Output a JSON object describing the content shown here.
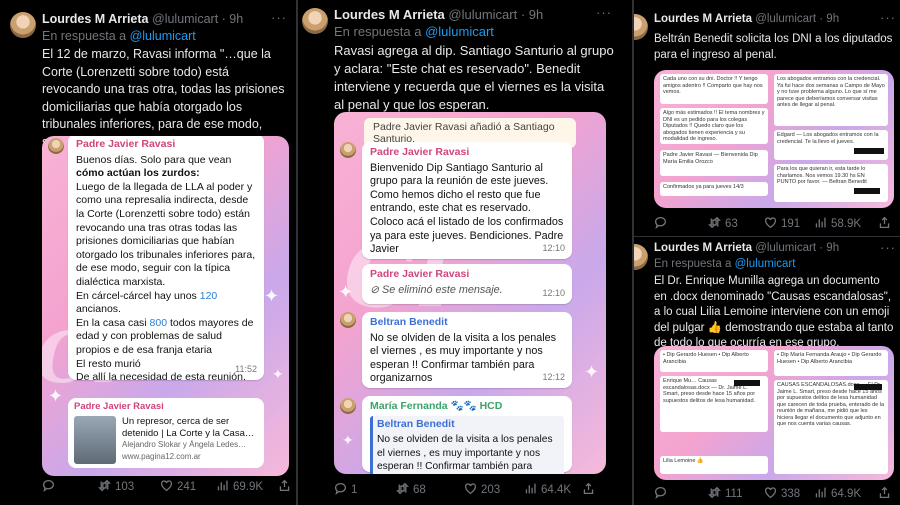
{
  "tweets": [
    {
      "name": "Lourdes M Arrieta",
      "handle": "@lulumicart",
      "time": "· 9h",
      "reply_prefix": "En respuesta a",
      "reply_handle": "@lulumicart",
      "text": "El 12 de marzo, Ravasi informa \"…que la Corte (Lorenzetti sobre todo) está revocando una tras otra, todas las prisiones domiciliarias que había otorgado los tribunales inferiores, para de ese modo, seguir con la típica dialéctica marxista\" bajando la línea discursiva y política",
      "media": {
        "sender": "Padre Javier Ravasi",
        "l1": "Buenos días. Solo para que vean",
        "l2": "cómo actúan los zurdos:",
        "body": "Luego de la llegada de LLA al poder y como una represalia indirecta, desde la Corte (Lorenzetti sobre todo) están revocando una tras otras todas las prisiones domiciliarias que habían otorgado los tribunales inferiores para, de ese modo, seguir con la típica dialéctica marxista.",
        "c1a": "En cárcel-cárcel hay unos ",
        "c1b": "120",
        "c1c": "ancianos.",
        "c2a": "En la casa casi ",
        "c2b": "800",
        "c2c": " todos mayores de edad y con problemas de salud propios e de esa franja etaria",
        "c3": "El resto murió",
        "c4": "De allí la necesidad de esta reunión.",
        "time": "11:52",
        "link_sender": "Padre Javier Ravasi",
        "link_title": "Un represor, cerca de ser detenido | La Corte y la Casa…",
        "link_sub": "Alejandro Slokar y Ángela Ledes…",
        "link_url": "www.pagina12.com.ar"
      },
      "stats": {
        "replies": "",
        "retweets": "103",
        "likes": "241",
        "views": "69.9K"
      }
    },
    {
      "name": "Lourdes M Arrieta",
      "handle": "@lulumicart",
      "time": "· 9h",
      "reply_prefix": "En respuesta a",
      "reply_handle": "@lulumicart",
      "text": "Ravasi agrega al dip. Santiago Santurio al grupo y aclara: \"Este chat es reservado\". Benedit interviene y recuerda que el viernes es la visita al penal y que los esperan.",
      "media": {
        "system": "Padre Javier Ravasi añadió a Santiago Santurio.",
        "b1_sender": "Padre Javier Ravasi",
        "b1_text": "Bienvenido Dip Santiago Santurio al grupo para la reunión de este jueves. Como hemos dicho el resto que fue entrando, este chat es reservado. Coloco acá el listado de los confirmados ya para este jueves. Bendiciones. Padre Javier",
        "b1_time": "12:10",
        "b2_sender": "Padre Javier Ravasi",
        "b2_text": "Se eliminó este mensaje.",
        "b2_time": "12:10",
        "b3_sender": "Beltran Benedit",
        "b3_text": "No se olviden de la visita a los penales el viernes , es muy importante y nos esperan !! Confirmar también para organizarnos",
        "b3_time": "12:12",
        "b4_sender": "María Fernanda 🐾🐾 HCD",
        "b4_quote_sender": "Beltran Benedit",
        "b4_quote_text": "No se olviden de la visita a los penales el viernes , es muy importante y nos esperan !! Confirmar también para organ…"
      },
      "stats": {
        "replies": "1",
        "retweets": "68",
        "likes": "203",
        "views": "64.4K"
      }
    },
    {
      "name": "Lourdes M Arrieta",
      "handle": "@lulumicart",
      "time": "· 9h",
      "text": "Beltrán Benedit solicita los DNI a los diputados para el ingreso al penal.",
      "stats": {
        "replies": "",
        "retweets": "63",
        "likes": "191",
        "views": "58.9K"
      }
    },
    {
      "name": "Lourdes M Arrieta",
      "handle": "@lulumicart",
      "time": "· 9h",
      "reply_prefix": "En respuesta a",
      "reply_handle": "@lulumicart",
      "text": "El Dr. Enrique Munilla agrega un documento en .docx denominado \"Causas escandalosas\", a lo cual Lilia Lemoine interviene con un emoji del pulgar 👍 demostrando que estaba al tanto de todo lo que ocurría en ese grupo.",
      "stats": {
        "replies": "",
        "retweets": "111",
        "likes": "338",
        "views": "64.9K"
      }
    }
  ],
  "colors": {
    "bg": "#000000",
    "text": "#e7e9ea",
    "muted": "#71767b",
    "link": "#1d9bf0"
  }
}
